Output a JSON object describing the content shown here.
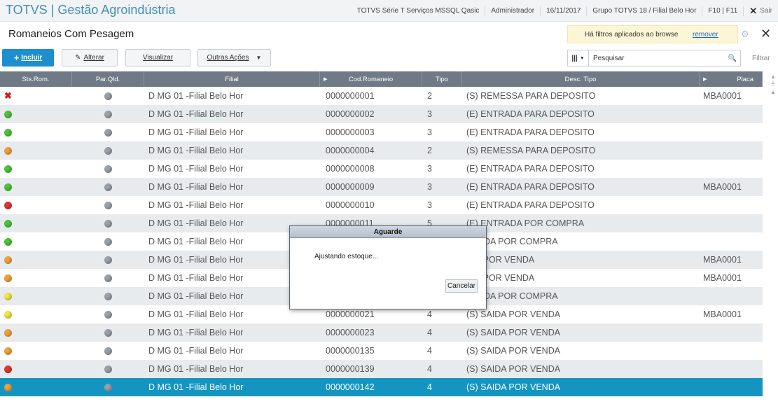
{
  "topbar": {
    "brand": "TOTVS | Gestão Agroindústria",
    "environment": "TOTVS Série T Serviços MSSQL Qasic",
    "user": "Administrador",
    "date": "16/11/2017",
    "branch": "Grupo TOTVS 18 / Filial Belo Hor",
    "shortcuts": "F10 | F11",
    "exit_label": "Sair"
  },
  "page": {
    "title": "Romaneios Com Pesagem",
    "filter_message": "Há filtros aplicados ao browse",
    "filter_remove": "remover"
  },
  "toolbar": {
    "incluir": "Incluir",
    "alterar": "Alterar",
    "visualizar": "Visualizar",
    "outras": "Outras Ações",
    "search_placeholder": "Pesquisar",
    "filtrar": "Filtrar"
  },
  "grid": {
    "headers": [
      "Sts.Rom.",
      "Par.Qld.",
      "Filial",
      "Cod.Romaneio",
      "Tipo",
      "Desc. Tipo",
      "Placa"
    ],
    "rows": [
      {
        "status": "x",
        "filial": "D MG 01 -Filial Belo Hor",
        "cod": "0000000001",
        "tipo": "2",
        "desc": "(S) REMESSA PARA DEPOSITO",
        "placa": "MBA0001"
      },
      {
        "status": "green",
        "filial": "D MG 01 -Filial Belo Hor",
        "cod": "0000000002",
        "tipo": "3",
        "desc": "(E) ENTRADA PARA DEPOSITO",
        "placa": ""
      },
      {
        "status": "green",
        "filial": "D MG 01 -Filial Belo Hor",
        "cod": "0000000003",
        "tipo": "3",
        "desc": "(E) ENTRADA PARA DEPOSITO",
        "placa": ""
      },
      {
        "status": "orange",
        "filial": "D MG 01 -Filial Belo Hor",
        "cod": "0000000004",
        "tipo": "2",
        "desc": "(S) REMESSA PARA DEPOSITO",
        "placa": ""
      },
      {
        "status": "green",
        "filial": "D MG 01 -Filial Belo Hor",
        "cod": "0000000008",
        "tipo": "3",
        "desc": "(E) ENTRADA PARA DEPOSITO",
        "placa": ""
      },
      {
        "status": "green",
        "filial": "D MG 01 -Filial Belo Hor",
        "cod": "0000000009",
        "tipo": "3",
        "desc": "(E) ENTRADA PARA DEPOSITO",
        "placa": "MBA0001"
      },
      {
        "status": "red",
        "filial": "D MG 01 -Filial Belo Hor",
        "cod": "0000000010",
        "tipo": "3",
        "desc": "(E) ENTRADA PARA DEPOSITO",
        "placa": ""
      },
      {
        "status": "green",
        "filial": "D MG 01 -Filial Belo Hor",
        "cod": "0000000011",
        "tipo": "5",
        "desc": "(E) ENTRADA POR COMPRA",
        "placa": ""
      },
      {
        "status": "green",
        "filial": "D MG 01 -Filial Belo Hor",
        "cod": "",
        "tipo": "",
        "desc": "TRADA POR COMPRA",
        "placa": ""
      },
      {
        "status": "orange",
        "filial": "D MG 01 -Filial Belo Hor",
        "cod": "",
        "tipo": "",
        "desc": "IDA POR VENDA",
        "placa": "MBA0001"
      },
      {
        "status": "orange",
        "filial": "D MG 01 -Filial Belo Hor",
        "cod": "",
        "tipo": "",
        "desc": "IDA POR VENDA",
        "placa": "MBA0001"
      },
      {
        "status": "yellow",
        "filial": "D MG 01 -Filial Belo Hor",
        "cod": "",
        "tipo": "",
        "desc": "TRADA POR COMPRA",
        "placa": ""
      },
      {
        "status": "yellow",
        "filial": "D MG 01 -Filial Belo Hor",
        "cod": "0000000021",
        "tipo": "4",
        "desc": "(S) SAIDA POR VENDA",
        "placa": "MBA0001"
      },
      {
        "status": "orange",
        "filial": "D MG 01 -Filial Belo Hor",
        "cod": "0000000023",
        "tipo": "4",
        "desc": "(S) SAIDA POR VENDA",
        "placa": ""
      },
      {
        "status": "orange",
        "filial": "D MG 01 -Filial Belo Hor",
        "cod": "0000000135",
        "tipo": "4",
        "desc": "(S) SAIDA POR VENDA",
        "placa": ""
      },
      {
        "status": "red",
        "filial": "D MG 01 -Filial Belo Hor",
        "cod": "0000000139",
        "tipo": "4",
        "desc": "(S) SAIDA POR VENDA",
        "placa": ""
      },
      {
        "status": "orange",
        "filial": "D MG 01 -Filial Belo Hor",
        "cod": "0000000142",
        "tipo": "4",
        "desc": "(S) SAIDA POR VENDA",
        "placa": "",
        "selected": true
      }
    ]
  },
  "dialog": {
    "title": "Aguarde",
    "message": "Ajustando estoque...",
    "cancel": "Cancelar"
  },
  "colors": {
    "green": "#4cc43a",
    "orange": "#f0a13a",
    "red": "#e03535",
    "yellow": "#f2e640",
    "accent": "#1d8fcf",
    "selected_row": "#1495c1"
  }
}
